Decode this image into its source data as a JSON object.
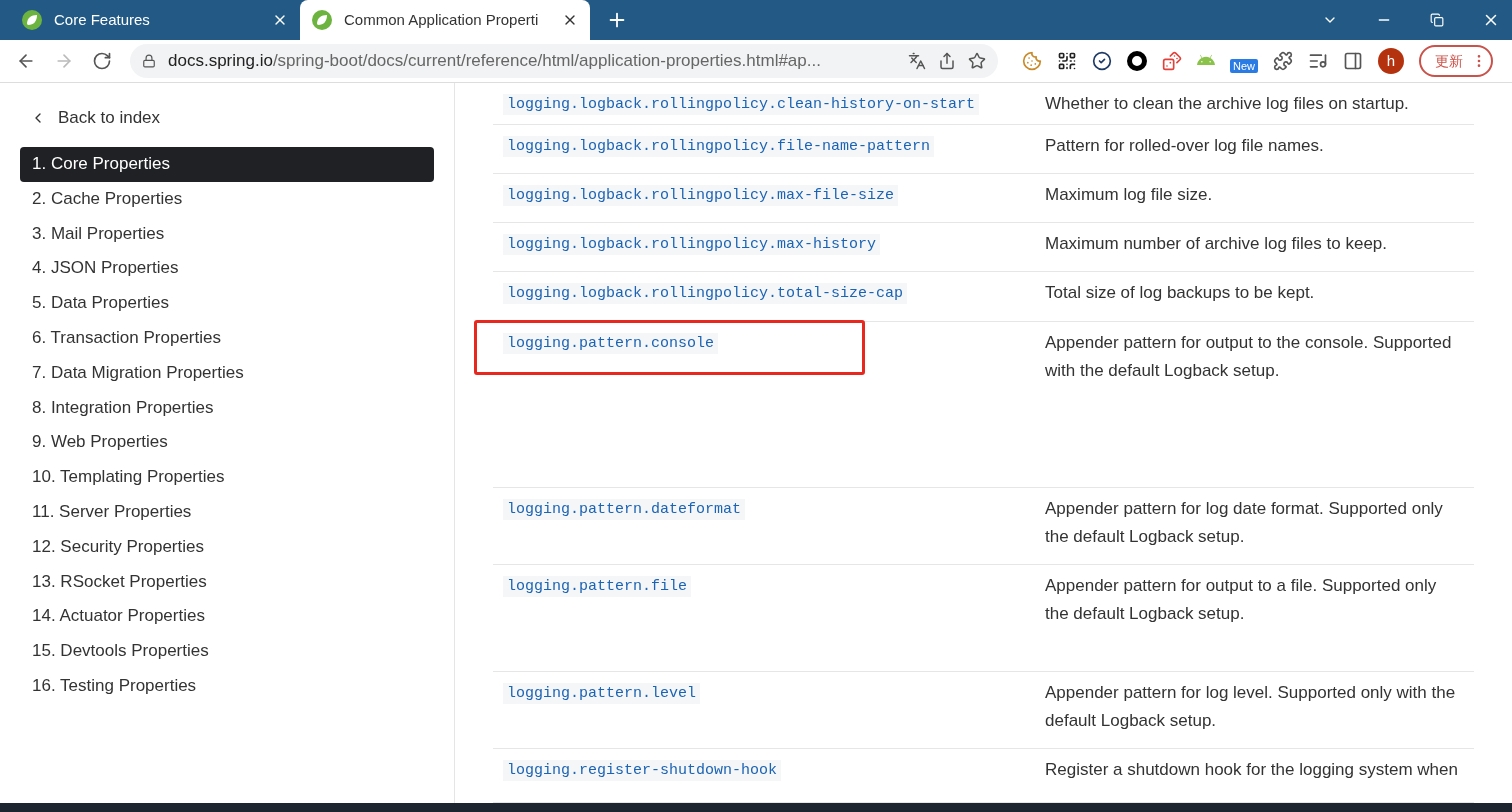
{
  "browser": {
    "tabs": [
      {
        "title": "Core Features",
        "selected": false
      },
      {
        "title": "Common Application Properti",
        "selected": true
      }
    ],
    "address": {
      "host": "docs.spring.io",
      "path": "/spring-boot/docs/current/reference/html/application-properties.html#ap..."
    },
    "extension_badge": "New",
    "profile_initial": "h",
    "update_button": "更新"
  },
  "sidebar": {
    "back_link": "Back to index",
    "items": [
      {
        "label": "1. Core Properties",
        "selected": true
      },
      {
        "label": "2. Cache Properties",
        "selected": false
      },
      {
        "label": "3. Mail Properties",
        "selected": false
      },
      {
        "label": "4. JSON Properties",
        "selected": false
      },
      {
        "label": "5. Data Properties",
        "selected": false
      },
      {
        "label": "6. Transaction Properties",
        "selected": false
      },
      {
        "label": "7. Data Migration Properties",
        "selected": false
      },
      {
        "label": "8. Integration Properties",
        "selected": false
      },
      {
        "label": "9. Web Properties",
        "selected": false
      },
      {
        "label": "10. Templating Properties",
        "selected": false
      },
      {
        "label": "11. Server Properties",
        "selected": false
      },
      {
        "label": "12. Security Properties",
        "selected": false
      },
      {
        "label": "13. RSocket Properties",
        "selected": false
      },
      {
        "label": "14. Actuator Properties",
        "selected": false
      },
      {
        "label": "15. Devtools Properties",
        "selected": false
      },
      {
        "label": "16. Testing Properties",
        "selected": false
      }
    ]
  },
  "table": {
    "rows": [
      {
        "key": "logging.logback.rollingpolicy.clean-history-on-start",
        "description": [
          "Whether to clean the archive log files on startup."
        ],
        "highlighted": false
      },
      {
        "key": "logging.logback.rollingpolicy.file-name-pattern",
        "description": [
          "Pattern for rolled-over log file names."
        ],
        "highlighted": false
      },
      {
        "key": "logging.logback.rollingpolicy.max-file-size",
        "description": [
          "Maximum log file size."
        ],
        "highlighted": false
      },
      {
        "key": "logging.logback.rollingpolicy.max-history",
        "description": [
          "Maximum number of archive log files to keep."
        ],
        "highlighted": false
      },
      {
        "key": "logging.logback.rollingpolicy.total-size-cap",
        "description": [
          "Total size of log backups to be kept."
        ],
        "highlighted": false
      },
      {
        "key": "logging.pattern.console",
        "description": [
          "Appender pattern for output to the console. Supported",
          "with the default Logback setup."
        ],
        "highlighted": true
      },
      {
        "key": "logging.pattern.dateformat",
        "description": [
          "Appender pattern for log date format. Supported only",
          "the default Logback setup."
        ],
        "highlighted": false
      },
      {
        "key": "logging.pattern.file",
        "description": [
          "Appender pattern for output to a file. Supported only",
          "the default Logback setup."
        ],
        "highlighted": false
      },
      {
        "key": "logging.pattern.level",
        "description": [
          "Appender pattern for log level. Supported only with the",
          "default Logback setup."
        ],
        "highlighted": false
      },
      {
        "key": "logging.register-shutdown-hook",
        "description": [
          "Register a shutdown hook for the logging system when"
        ],
        "highlighted": false
      }
    ]
  }
}
